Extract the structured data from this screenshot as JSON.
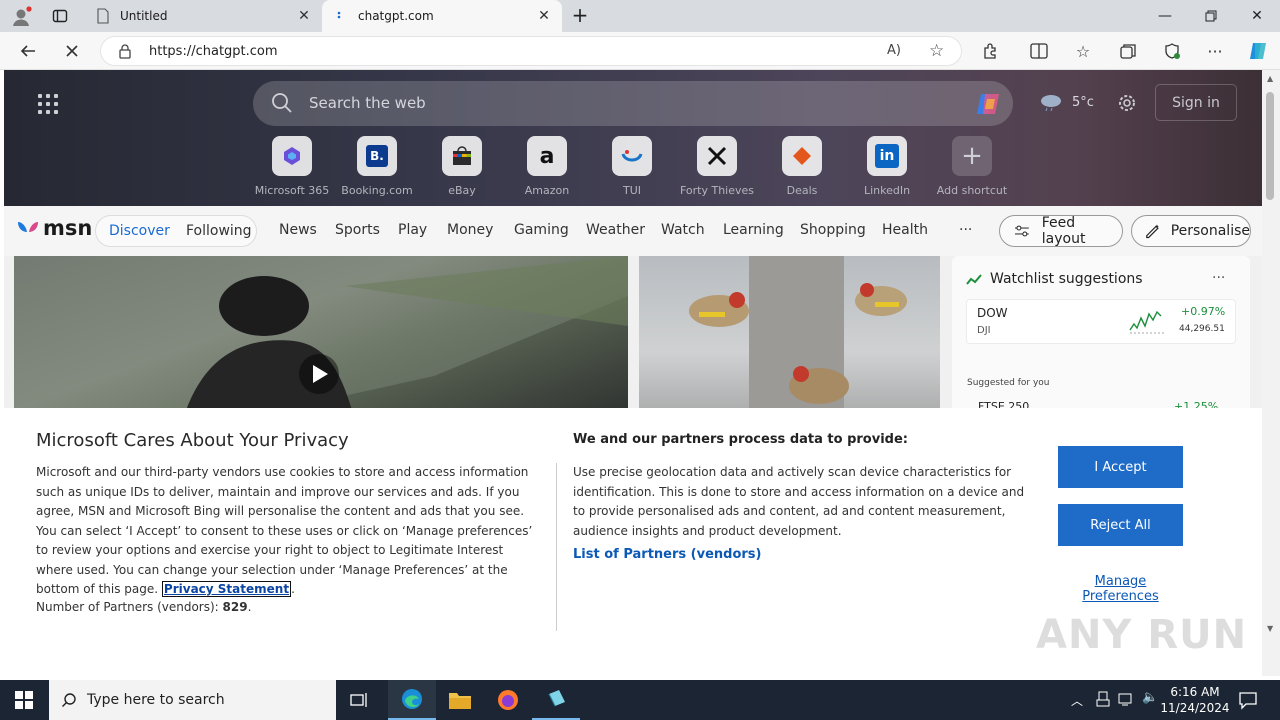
{
  "browser": {
    "tabs": [
      {
        "label": "Untitled"
      },
      {
        "label": "chatgpt.com"
      }
    ],
    "url": "https://chatgpt.com"
  },
  "msn": {
    "search_placeholder": "Search the web",
    "temperature": "5°c",
    "sign_in": "Sign in",
    "shortcuts": [
      {
        "label": "Microsoft 365",
        "icon": "microsoft-365-icon"
      },
      {
        "label": "Booking.com",
        "icon": "booking-icon"
      },
      {
        "label": "eBay",
        "icon": "ebay-icon"
      },
      {
        "label": "Amazon",
        "icon": "amazon-icon"
      },
      {
        "label": "TUI",
        "icon": "tui-icon"
      },
      {
        "label": "Forty Thieves",
        "icon": "forty-thieves-icon"
      },
      {
        "label": "Deals",
        "icon": "deals-icon"
      },
      {
        "label": "LinkedIn",
        "icon": "linkedin-icon"
      },
      {
        "label": "Add shortcut",
        "icon": "plus-icon"
      }
    ],
    "logo": "msn",
    "discover": "Discover",
    "following": "Following",
    "categories": [
      "News",
      "Sports",
      "Play",
      "Money",
      "Gaming",
      "Weather",
      "Watch",
      "Learning",
      "Shopping",
      "Health"
    ],
    "more": "···",
    "feed_layout": "Feed layout",
    "personalise": "Personalise",
    "watchlist": {
      "title": "Watchlist suggestions",
      "more": "···",
      "item": {
        "name": "DOW",
        "ticker": "DJI",
        "change": "+0.97%",
        "value": "44,296.51"
      },
      "suggested": "Suggested for you",
      "partial": "FTSE 250",
      "partial_change": "+1.25%"
    }
  },
  "privacy": {
    "title": "Microsoft Cares About Your Privacy",
    "body": "Microsoft and our third-party vendors use cookies to store and access information such as unique IDs to deliver, maintain and improve our services and ads. If you agree, MSN and Microsoft Bing will personalise the content and ads that you see. You can select ‘I Accept’ to consent to these uses or click on ‘Manage preferences’ to review your options and exercise your right to object to Legitimate Interest where used.  You can change your selection under ‘Manage Preferences’ at the bottom of this page.",
    "privacy_link": "Privacy Statement",
    "partners_count_label": "Number of Partners (vendors):",
    "partners_count": "829",
    "heading2": "We and our partners process data to provide:",
    "body2": "Use precise geolocation data and actively scan device characteristics for identification. This is done to store and access information on a device and to provide personalised ads and content, ad and content measurement, audience insights and product development.",
    "partners_link": "List of Partners (vendors)",
    "accept": "I Accept",
    "reject": "Reject All",
    "manage": "Manage Preferences"
  },
  "watermark": "ANY RUN",
  "taskbar": {
    "search_placeholder": "Type here to search",
    "time": "6:16 AM",
    "date": "11/24/2024"
  },
  "colors": {
    "accent": "#1e6cc8",
    "link": "#0b59b5",
    "taskbar": "#1c2533"
  }
}
